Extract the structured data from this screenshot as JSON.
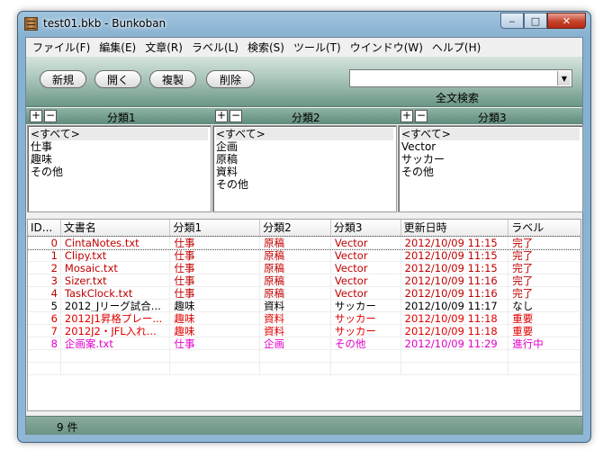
{
  "window": {
    "title": "test01.bkb - Bunkoban",
    "minimize": "‒",
    "maximize": "□",
    "close": "✕"
  },
  "menu": [
    "ファイル(F)",
    "編集(E)",
    "文章(R)",
    "ラベル(L)",
    "検索(S)",
    "ツール(T)",
    "ウインドウ(W)",
    "ヘルプ(H)"
  ],
  "toolbar": {
    "buttons": [
      "新規",
      "開く",
      "複製",
      "削除"
    ],
    "search_value": "",
    "search_label": "全文検索"
  },
  "categories": [
    {
      "title": "分類1",
      "items": [
        "<すべて>",
        "仕事",
        "趣味",
        "その他"
      ]
    },
    {
      "title": "分類2",
      "items": [
        "<すべて>",
        "企画",
        "原稿",
        "資料",
        "その他"
      ]
    },
    {
      "title": "分類3",
      "items": [
        "<すべて>",
        "Vector",
        "サッカー",
        "その他"
      ]
    }
  ],
  "table": {
    "columns": [
      "ID...",
      "文書名",
      "分類1",
      "分類2",
      "分類3",
      "更新日時",
      "ラベル"
    ],
    "rows": [
      {
        "id": "0",
        "name": "CintaNotes.txt",
        "c1": "仕事",
        "c2": "原稿",
        "c3": "Vector",
        "date": "2012/10/09 11:15",
        "label": "完了",
        "color": "#c00000"
      },
      {
        "id": "1",
        "name": "Clipy.txt",
        "c1": "仕事",
        "c2": "原稿",
        "c3": "Vector",
        "date": "2012/10/09 11:15",
        "label": "完了",
        "color": "#c00000"
      },
      {
        "id": "2",
        "name": "Mosaic.txt",
        "c1": "仕事",
        "c2": "原稿",
        "c3": "Vector",
        "date": "2012/10/09 11:15",
        "label": "完了",
        "color": "#c00000"
      },
      {
        "id": "3",
        "name": "Sizer.txt",
        "c1": "仕事",
        "c2": "原稿",
        "c3": "Vector",
        "date": "2012/10/09 11:16",
        "label": "完了",
        "color": "#c00000"
      },
      {
        "id": "4",
        "name": "TaskClock.txt",
        "c1": "仕事",
        "c2": "原稿",
        "c3": "Vector",
        "date": "2012/10/09 11:16",
        "label": "完了",
        "color": "#c00000"
      },
      {
        "id": "5",
        "name": "2012_Jリーグ試合...",
        "c1": "趣味",
        "c2": "資料",
        "c3": "サッカー",
        "date": "2012/10/09 11:17",
        "label": "なし",
        "color": "#000000"
      },
      {
        "id": "6",
        "name": "2012J1昇格プレー...",
        "c1": "趣味",
        "c2": "資料",
        "c3": "サッカー",
        "date": "2012/10/09 11:18",
        "label": "重要",
        "color": "#e00000"
      },
      {
        "id": "7",
        "name": "2012J2・JFL入れ...",
        "c1": "趣味",
        "c2": "資料",
        "c3": "サッカー",
        "date": "2012/10/09 11:18",
        "label": "重要",
        "color": "#e00000"
      },
      {
        "id": "8",
        "name": "企画案.txt",
        "c1": "仕事",
        "c2": "企画",
        "c3": "その他",
        "date": "2012/10/09 11:29",
        "label": "進行中",
        "color": "#e000c8"
      }
    ]
  },
  "status": {
    "count": "9 件"
  }
}
